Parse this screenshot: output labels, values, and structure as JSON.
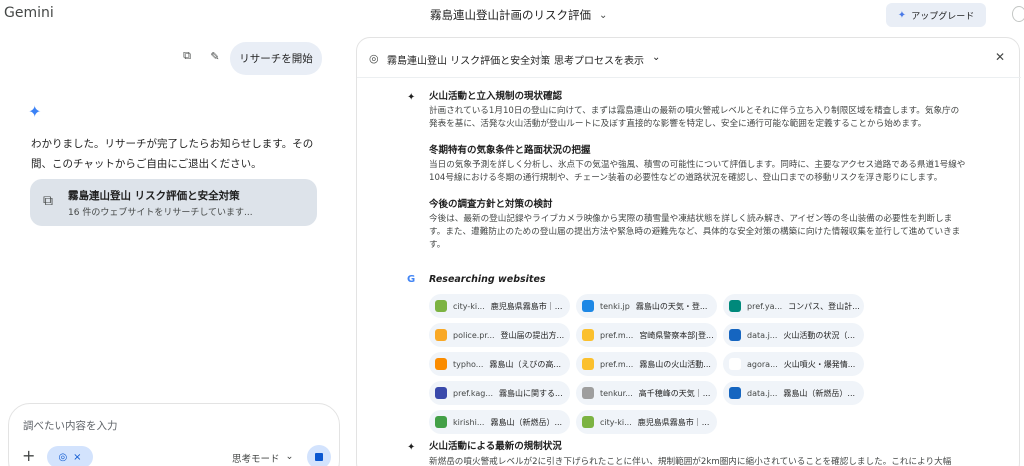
{
  "app": {
    "brand": "Gemini",
    "conversation_title": "霧島連山登山計画のリスク評価",
    "upgrade_label": "アップグレード"
  },
  "chat": {
    "user_message": "リサーチを開始",
    "reply": "わかりました。リサーチが完了したらお知らせします。その間、このチャットからご自由にご退出ください。",
    "card_title": "霧島連山登山 リスク評価と安全対策",
    "card_subtitle": "16 件のウェブサイトをリサーチしています..."
  },
  "composer": {
    "placeholder": "調べたい内容を入力",
    "mode_label": "思考モード"
  },
  "panel": {
    "title": "霧島連山登山 リスク評価と安全対策",
    "think_label": "思考プロセスを表示",
    "steps": [
      {
        "heading": "火山活動と立入規制の現状確認",
        "body": "計画されている1月10日の登山に向けて、まずは霧島連山の最新の噴火警戒レベルとそれに伴う立ち入り制限区域を精査します。気象庁の発表を基に、活発な火山活動が登山ルートに及ぼす直接的な影響を特定し、安全に通行可能な範囲を定義することから始めます。"
      },
      {
        "heading": "冬期特有の気象条件と路面状況の把握",
        "body": "当日の気象予測を詳しく分析し、氷点下の気温や強風、積雪の可能性について評価します。同時に、主要なアクセス道路である県道1号線や104号線における冬期の通行規制や、チェーン装着の必要性などの道路状況を確認し、登山口までの移動リスクを浮き彫りにします。"
      },
      {
        "heading": "今後の調査方針と対策の検討",
        "body": "今後は、最新の登山記録やライブカメラ映像から実際の積雪量や凍結状態を詳しく読み解き、アイゼン等の冬山装備の必要性を判断します。また、遭難防止のための登山届の提出方法や緊急時の避難先など、具体的な安全対策の構築に向けた情報収集を並行して進めていきます。"
      }
    ],
    "research_label": "Researching websites",
    "sources": [
      {
        "site": "city-ki...",
        "name": "鹿児島県霧島市｜...",
        "color": "#7cb342"
      },
      {
        "site": "tenki.jp",
        "name": "霧島山の天気・登...",
        "color": "#1e88e5"
      },
      {
        "site": "pref.ya...",
        "name": "コンパス、登山計...",
        "color": "#00897b"
      },
      {
        "site": "police.pr...",
        "name": "登山届の提出方...",
        "color": "#f9a825"
      },
      {
        "site": "pref.m...",
        "name": "宮崎県警察本部|登...",
        "color": "#fbc02d"
      },
      {
        "site": "data.j...",
        "name": "火山活動の状況（...",
        "color": "#1565c0"
      },
      {
        "site": "typho...",
        "name": "霧島山（えびの高...",
        "color": "#fb8c00"
      },
      {
        "site": "pref.m...",
        "name": "霧島山の火山活動...",
        "color": "#fbc02d"
      },
      {
        "site": "agora...",
        "name": "火山噴火・爆発情...",
        "color": "#ffffff"
      },
      {
        "site": "pref.kag...",
        "name": "霧島山に関する...",
        "color": "#3949ab"
      },
      {
        "site": "tenkur...",
        "name": "高千穂峰の天気｜...",
        "color": "#9e9e9e"
      },
      {
        "site": "data.j...",
        "name": "霧島山（新燃岳）...",
        "color": "#1565c0"
      },
      {
        "site": "kirishi...",
        "name": "霧島山（新燃岳）...",
        "color": "#43a047"
      },
      {
        "site": "city-ki...",
        "name": "鹿児島県霧島市｜...",
        "color": "#7cb342"
      }
    ],
    "last_step": {
      "heading": "火山活動による最新の規制状況",
      "body": "新燃岳の噴火警戒レベルが2に引き下げられたことに伴い、規制範囲が2km圏内に縮小されていることを確認しました。これにより大幅"
    }
  }
}
